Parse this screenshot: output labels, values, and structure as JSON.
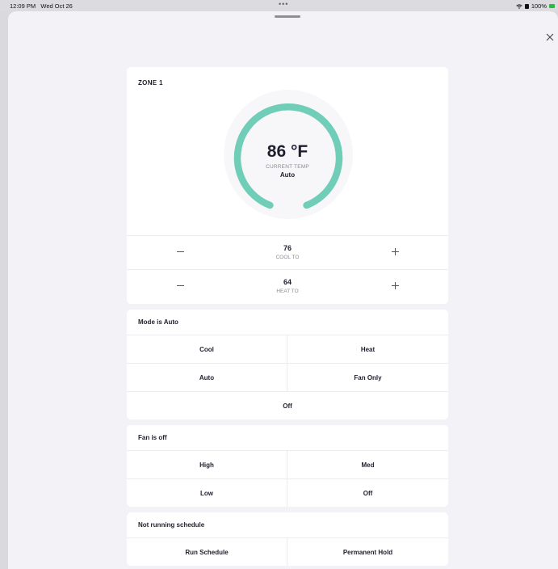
{
  "status": {
    "time": "12:09 PM",
    "date": "Wed Oct 26",
    "dots": "•••",
    "battery": "100%"
  },
  "zone": {
    "title": "ZONE 1",
    "current_temp": "86 °F",
    "current_label": "CURRENT TEMP",
    "mode": "Auto",
    "cool": {
      "value": "76",
      "label": "COOL TO"
    },
    "heat": {
      "value": "64",
      "label": "HEAT TO"
    }
  },
  "mode_card": {
    "title": "Mode is Auto",
    "options": [
      "Cool",
      "Heat",
      "Auto",
      "Fan Only",
      "Off"
    ]
  },
  "fan_card": {
    "title": "Fan is off",
    "options": [
      "High",
      "Med",
      "Low",
      "Off"
    ]
  },
  "schedule_card": {
    "title": "Not running schedule",
    "options": [
      "Run Schedule",
      "Permanent Hold"
    ]
  },
  "colors": {
    "dial": "#6fcdb8",
    "background": "#f2f2f7"
  }
}
